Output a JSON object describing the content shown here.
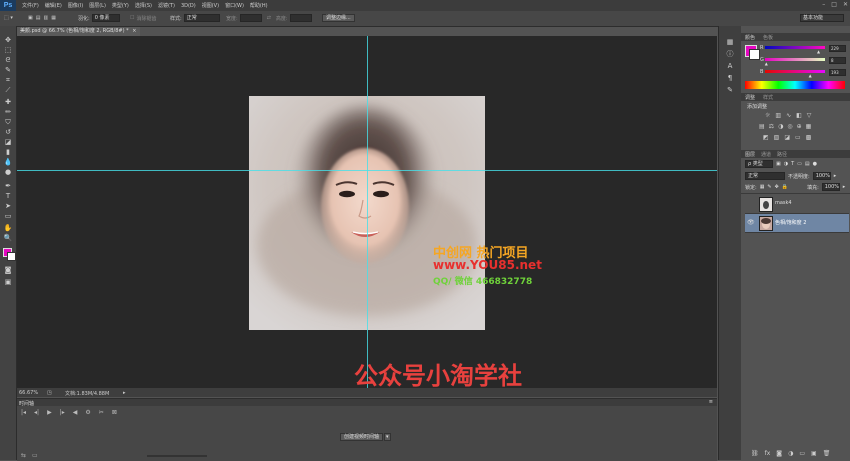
{
  "app": {
    "logo": "Ps",
    "menu": [
      "文件(F)",
      "编辑(E)",
      "图像(I)",
      "图层(L)",
      "类型(Y)",
      "选择(S)",
      "滤镜(T)",
      "3D(D)",
      "视图(V)",
      "窗口(W)",
      "帮助(H)"
    ]
  },
  "options": {
    "feather_label": "羽化:",
    "feather_value": "0 像素",
    "antialias_label": "消除锯齿",
    "style_label": "样式:",
    "style_value": "正常",
    "width_label": "宽度:",
    "height_label": "高度:",
    "refine_button": "调整边缘...",
    "workspace": "基本功能"
  },
  "document": {
    "tab_title": "美颜.psd @ 66.7% (色相/饱和度 2, RGB/8#) *",
    "zoom": "66.67%",
    "doc_info": "文档:1.83M/4.88M"
  },
  "overlay": {
    "watermark_line1": "中创网 热门项目",
    "watermark_line2": "www.YOU85.net",
    "watermark_line3": "QQ/ 微信 466832778",
    "caption": "公众号小淘学社"
  },
  "timeline": {
    "panel_title": "时间轴",
    "create_button": "创建视频时间轴"
  },
  "color_panel": {
    "tabs": [
      "颜色",
      "色板"
    ],
    "channels": [
      {
        "label": "R",
        "value": "229",
        "level": 0.9
      },
      {
        "label": "G",
        "value": "8",
        "level": 0.03
      },
      {
        "label": "B",
        "value": "193",
        "level": 0.76
      }
    ],
    "foreground": "#e508c1"
  },
  "adjustments_panel": {
    "tabs": [
      "调整",
      "样式"
    ],
    "add_label": "添加调整"
  },
  "layers_panel": {
    "tabs": [
      "图层",
      "通道",
      "路径"
    ],
    "kind": "类型",
    "blend_mode": "正常",
    "opacity_label": "不透明度:",
    "opacity_value": "100%",
    "lock_label": "锁定:",
    "fill_label": "填充:",
    "fill_value": "100%",
    "layers": [
      {
        "name": "mask4",
        "selected": false
      },
      {
        "name": "色相/饱和度 2",
        "selected": true
      }
    ]
  },
  "colors": {
    "accent": "#46e0e8",
    "caption_red": "#e8413e",
    "watermark_orange": "#f5a623",
    "watermark_red": "#e8302e",
    "watermark_green": "#6fd23a"
  }
}
